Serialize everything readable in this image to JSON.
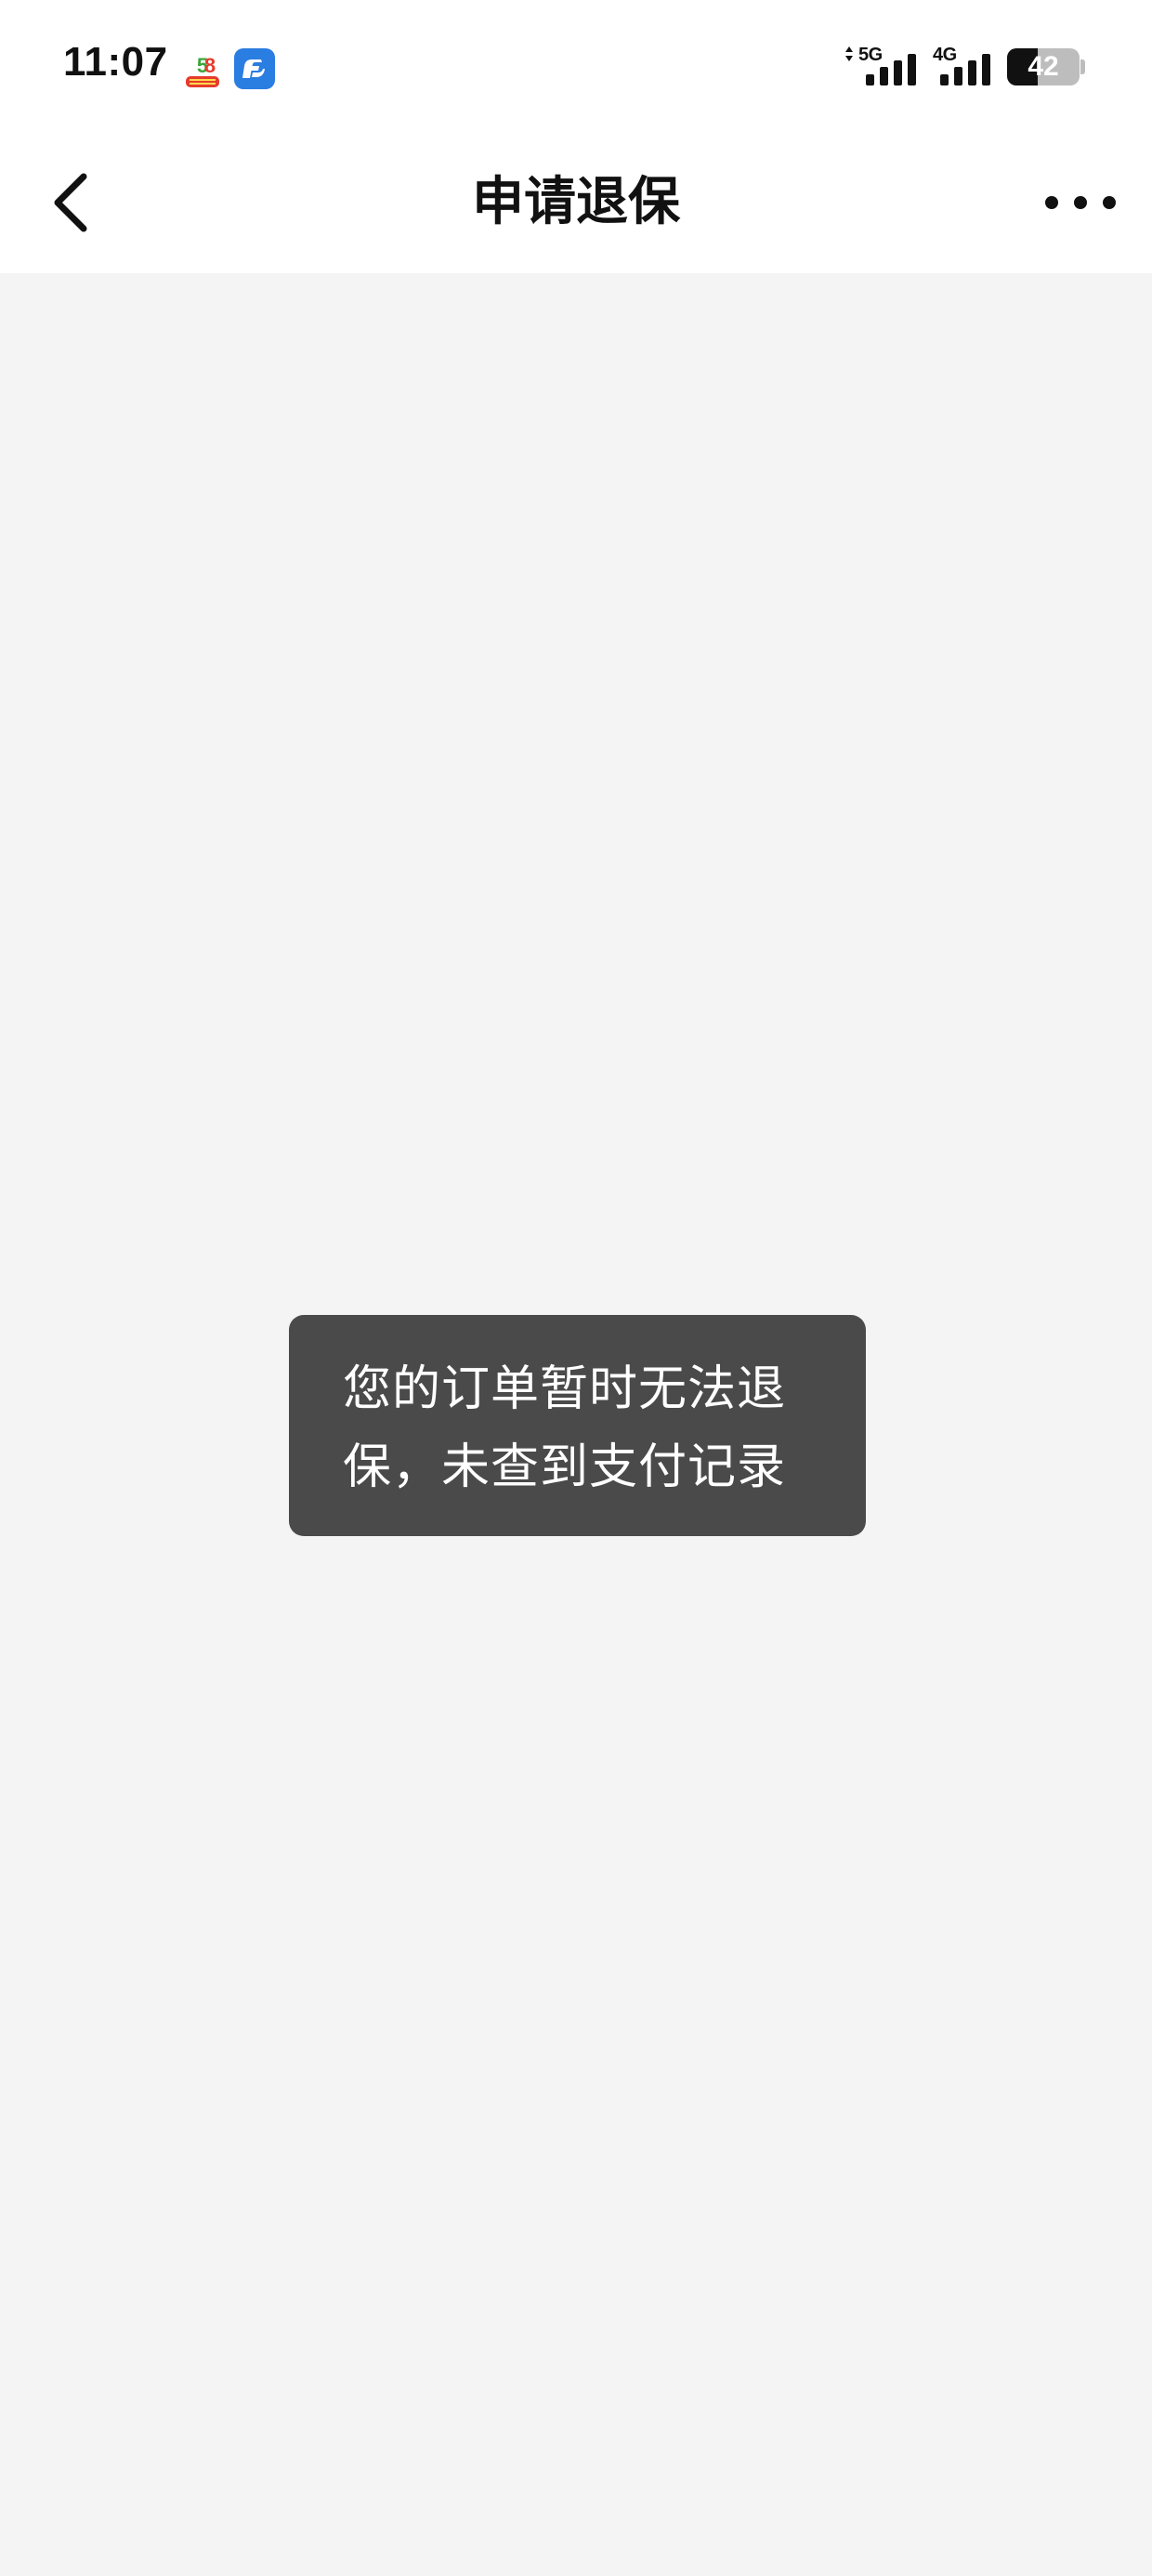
{
  "status_bar": {
    "time": "11:07",
    "app_icons": [
      "58-app-icon",
      "blue-app-icon"
    ],
    "network_1": "5G",
    "network_2": "4G",
    "battery_level": "42"
  },
  "nav": {
    "title": "申请退保",
    "back_icon": "chevron-left-icon",
    "more_icon": "more-dots-icon"
  },
  "toast": {
    "line1": "您的订单暂时无法退",
    "line2": "保，未查到支付记录"
  },
  "colors": {
    "page_background": "#f4f4f4",
    "bar_background": "#ffffff",
    "toast_background": "#4a4a4a",
    "toast_text": "#ffffff",
    "app_icon_blue": "#2a7de1"
  }
}
